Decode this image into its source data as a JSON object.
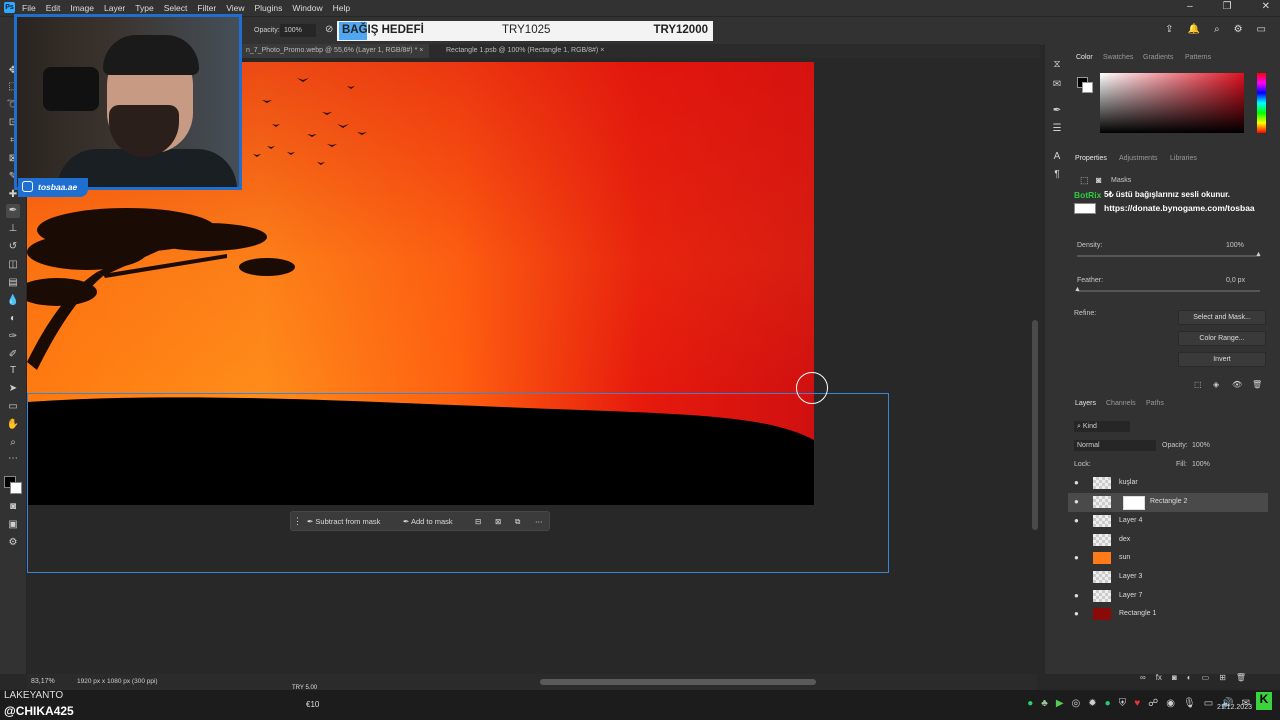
{
  "menu": {
    "app_icon": "Ps",
    "items": [
      "File",
      "Edit",
      "Image",
      "Layer",
      "Type",
      "Select",
      "Filter",
      "View",
      "Plugins",
      "Window",
      "Help"
    ]
  },
  "options_bar": {
    "opacity_label": "Opacity:",
    "opacity_value": "100%"
  },
  "donation": {
    "title": "BAĞIŞ HEDEFİ",
    "current": "TRY1025",
    "goal": "TRY12000",
    "highlight_color": "#4ea7f0"
  },
  "tabs": [
    {
      "label": "n_7_Photo_Promo.webp @ 55,6% (Layer 1, RGB/8#) *",
      "close": "×"
    },
    {
      "label": "Rectangle 1.psb @ 100% (Rectangle 1, RGB/8#)",
      "close": "×"
    }
  ],
  "webcam": {
    "social_handle": "tosbaa.ae",
    "social_icon": "instagram-icon",
    "frame_color": "#1e6fd0"
  },
  "context_bar": {
    "subtract": "Subtract from mask",
    "add": "Add to mask",
    "more": "⋯"
  },
  "status": {
    "zoom": "83,17%",
    "dimensions": "1920 px x 1080 px (300 ppi)"
  },
  "color_panel": {
    "tabs": [
      "Color",
      "Swatches",
      "Gradients",
      "Patterns"
    ],
    "active_tab": "Color"
  },
  "properties": {
    "tabs": [
      "Properties",
      "Adjustments",
      "Libraries"
    ],
    "section": "Masks",
    "density_label": "Density:",
    "density_value": "100%",
    "feather_label": "Feather:",
    "feather_value": "0,0 px",
    "refine_label": "Refine:",
    "buttons": [
      "Select and Mask...",
      "Color Range...",
      "Invert"
    ]
  },
  "bot_overlay": {
    "bot_name": "BotRix",
    "line1": "5₺ üstü bağışlarınız sesli okunur.",
    "line2": "https://donate.bynogame.com/tosbaa"
  },
  "layers": {
    "tabs": [
      "Layers",
      "Channels",
      "Paths"
    ],
    "filter_kind": "Kind",
    "blend_mode": "Normal",
    "opacity_label": "Opacity:",
    "opacity_value": "100%",
    "lock_label": "Lock:",
    "fill_label": "Fill:",
    "fill_value": "100%",
    "rows": [
      {
        "name": "kuşlar",
        "visible": true
      },
      {
        "name": "Rectangle 2",
        "visible": true,
        "selected": true
      },
      {
        "name": "Layer 4",
        "visible": true
      },
      {
        "name": "dex",
        "visible": false
      },
      {
        "name": "sun",
        "visible": true
      },
      {
        "name": "Layer 3",
        "visible": false
      },
      {
        "name": "Layer 7",
        "visible": true
      },
      {
        "name": "Rectangle 1",
        "visible": true
      }
    ]
  },
  "taskbar": {
    "streamer": "LAKEYANTO",
    "handle": "@CHIKA425",
    "try_label": "TRY 5.00",
    "eur_label": "€10",
    "date": "21.12.2023"
  }
}
